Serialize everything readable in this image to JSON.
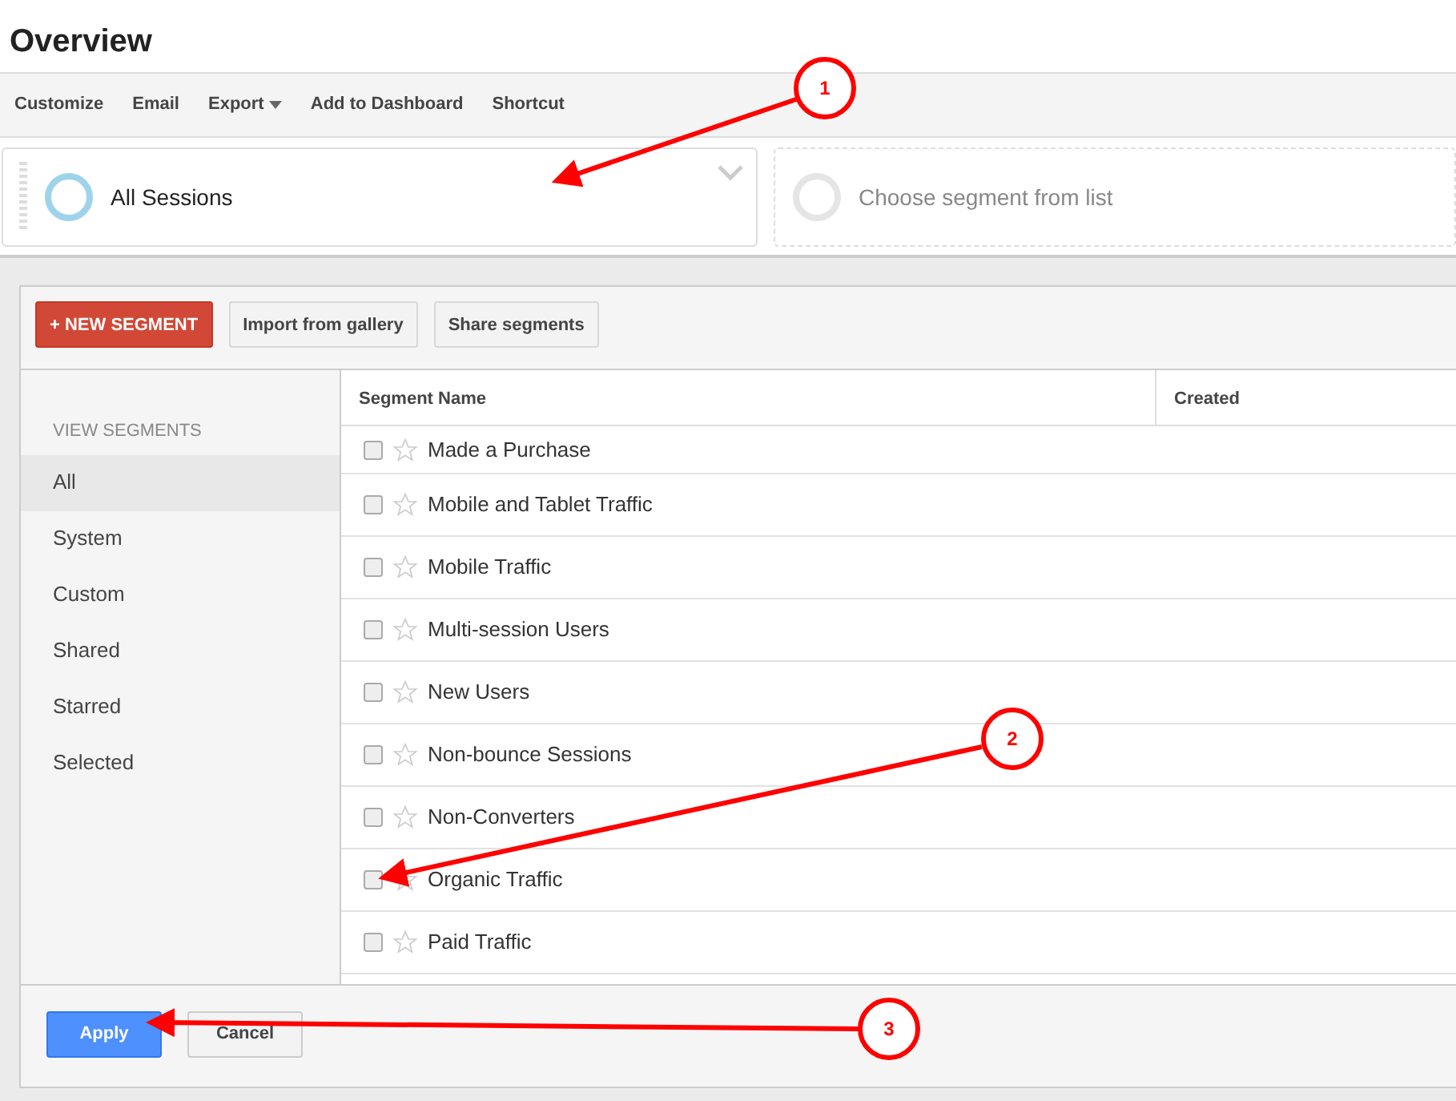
{
  "page_title": "Overview",
  "toolbar": [
    {
      "label": "Customize",
      "dropdown": false
    },
    {
      "label": "Email",
      "dropdown": false
    },
    {
      "label": "Export",
      "dropdown": true
    },
    {
      "label": "Add to Dashboard",
      "dropdown": false
    },
    {
      "label": "Shortcut",
      "dropdown": false
    }
  ],
  "segment_slots": [
    {
      "label": "All Sessions",
      "kind": "active"
    },
    {
      "label": "Choose segment from list",
      "kind": "empty"
    }
  ],
  "panel_buttons": [
    {
      "label": "+ NEW SEGMENT",
      "kind": "primary"
    },
    {
      "label": "Import from gallery",
      "kind": "default"
    },
    {
      "label": "Share segments",
      "kind": "default"
    }
  ],
  "sidebar": {
    "heading": "VIEW SEGMENTS",
    "items": [
      {
        "label": "All",
        "selected": true
      },
      {
        "label": "System",
        "selected": false
      },
      {
        "label": "Custom",
        "selected": false
      },
      {
        "label": "Shared",
        "selected": false
      },
      {
        "label": "Starred",
        "selected": false
      },
      {
        "label": "Selected",
        "selected": false
      }
    ]
  },
  "table": {
    "columns": [
      "Segment Name",
      "Created"
    ],
    "rows": [
      {
        "name": "Made a Purchase",
        "checked": false
      },
      {
        "name": "Mobile and Tablet Traffic",
        "checked": false
      },
      {
        "name": "Mobile Traffic",
        "checked": false
      },
      {
        "name": "Multi-session Users",
        "checked": false
      },
      {
        "name": "New Users",
        "checked": false
      },
      {
        "name": "Non-bounce Sessions",
        "checked": false
      },
      {
        "name": "Non-Converters",
        "checked": false
      },
      {
        "name": "Organic Traffic",
        "checked": false
      },
      {
        "name": "Paid Traffic",
        "checked": false
      }
    ]
  },
  "footer_buttons": [
    {
      "label": "Apply",
      "kind": "primary"
    },
    {
      "label": "Cancel",
      "kind": "default"
    }
  ],
  "callouts": [
    "1",
    "2",
    "3"
  ]
}
